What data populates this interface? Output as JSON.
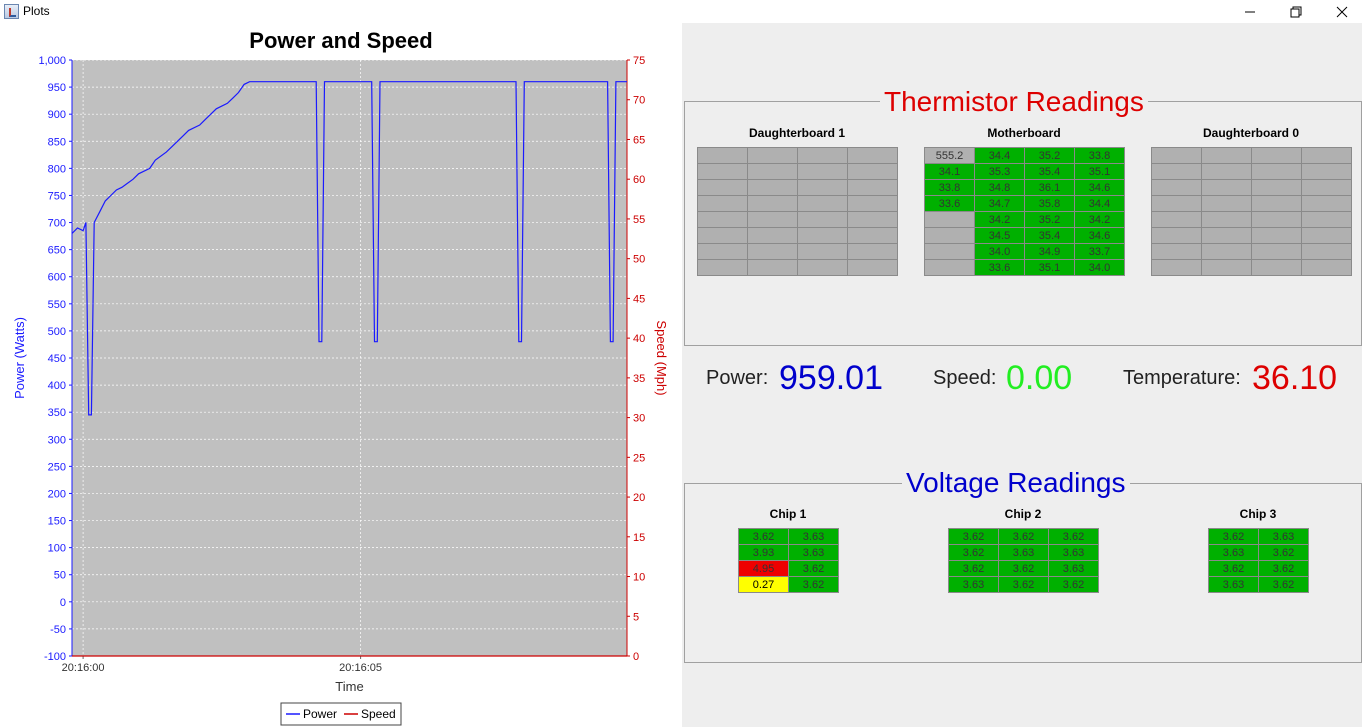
{
  "window": {
    "title": "Plots",
    "min_icon": "minimize-icon",
    "max_icon": "restore-icon",
    "close_icon": "close-icon"
  },
  "chart_data": {
    "type": "line",
    "title": "Power and Speed",
    "xlabel": "Time",
    "ylabel": "Power (Watts)",
    "y2label": "Speed (Mph)",
    "x_ticks": [
      "20:16:00",
      "20:16:05"
    ],
    "ylim": [
      -100,
      1000
    ],
    "y2lim": [
      0,
      75
    ],
    "y_ticks": [
      -100,
      -50,
      0,
      50,
      100,
      150,
      200,
      250,
      300,
      350,
      400,
      450,
      500,
      550,
      600,
      650,
      700,
      750,
      800,
      850,
      900,
      950,
      1000
    ],
    "y2_ticks": [
      0,
      5,
      10,
      15,
      20,
      25,
      30,
      35,
      40,
      45,
      50,
      55,
      60,
      65,
      70,
      75
    ],
    "xlim": [
      -0.2,
      9.8
    ],
    "grid": true,
    "background": "#c0c0c0",
    "legend_position": "bottom",
    "series": [
      {
        "name": "Power",
        "axis": "left",
        "color": "#1a1aff",
        "x": [
          -0.2,
          -0.1,
          0.0,
          0.05,
          0.1,
          0.15,
          0.2,
          0.3,
          0.4,
          0.5,
          0.6,
          0.7,
          0.9,
          1.0,
          1.2,
          1.3,
          1.5,
          1.6,
          1.8,
          1.9,
          2.1,
          2.2,
          2.4,
          2.6,
          2.7,
          2.8,
          2.9,
          3.0,
          3.0,
          4.2,
          4.25,
          4.3,
          4.35,
          5.2,
          5.25,
          5.3,
          5.35,
          7.8,
          7.85,
          7.9,
          7.95,
          9.45,
          9.5,
          9.55,
          9.6,
          9.8
        ],
        "y": [
          680,
          690,
          685,
          700,
          345,
          345,
          700,
          720,
          740,
          750,
          760,
          765,
          780,
          790,
          800,
          815,
          830,
          840,
          860,
          870,
          880,
          890,
          910,
          920,
          930,
          940,
          955,
          960,
          960,
          960,
          480,
          480,
          960,
          960,
          480,
          480,
          960,
          960,
          480,
          480,
          960,
          960,
          480,
          480,
          960,
          960
        ]
      },
      {
        "name": "Speed",
        "axis": "right",
        "color": "#cc0000",
        "x": [
          -0.2,
          9.8
        ],
        "y": [
          0,
          0
        ]
      }
    ]
  },
  "thermistor": {
    "title": "Thermistor Readings",
    "title_color": "#dd0000",
    "boards": [
      {
        "name": "Daughterboard 1",
        "cells": [
          [
            "",
            "",
            "",
            ""
          ],
          [
            "",
            "",
            "",
            ""
          ],
          [
            "",
            "",
            "",
            ""
          ],
          [
            "",
            "",
            "",
            ""
          ],
          [
            "",
            "",
            "",
            ""
          ],
          [
            "",
            "",
            "",
            ""
          ],
          [
            "",
            "",
            "",
            ""
          ],
          [
            "",
            "",
            "",
            ""
          ]
        ],
        "colors": [
          [
            "g",
            "g",
            "g",
            "g"
          ],
          [
            "g",
            "g",
            "g",
            "g"
          ],
          [
            "g",
            "g",
            "g",
            "g"
          ],
          [
            "g",
            "g",
            "g",
            "g"
          ],
          [
            "g",
            "g",
            "g",
            "g"
          ],
          [
            "g",
            "g",
            "g",
            "g"
          ],
          [
            "g",
            "g",
            "g",
            "g"
          ],
          [
            "g",
            "g",
            "g",
            "g"
          ]
        ]
      },
      {
        "name": "Motherboard",
        "cells": [
          [
            "555.2",
            "34.4",
            "35.2",
            "33.8"
          ],
          [
            "34.1",
            "35.3",
            "35.4",
            "35.1"
          ],
          [
            "33.8",
            "34.8",
            "36.1",
            "34.6"
          ],
          [
            "33.6",
            "34.7",
            "35.8",
            "34.4"
          ],
          [
            "",
            "34.2",
            "35.2",
            "34.2"
          ],
          [
            "",
            "34.5",
            "35.4",
            "34.6"
          ],
          [
            "",
            "34.0",
            "34.9",
            "33.7"
          ],
          [
            "",
            "33.6",
            "35.1",
            "34.0"
          ]
        ],
        "colors": [
          [
            "g",
            "G",
            "G",
            "G"
          ],
          [
            "G",
            "G",
            "G",
            "G"
          ],
          [
            "G",
            "G",
            "G",
            "G"
          ],
          [
            "G",
            "G",
            "G",
            "G"
          ],
          [
            "g",
            "G",
            "G",
            "G"
          ],
          [
            "g",
            "G",
            "G",
            "G"
          ],
          [
            "g",
            "G",
            "G",
            "G"
          ],
          [
            "g",
            "G",
            "G",
            "G"
          ]
        ]
      },
      {
        "name": "Daughterboard 0",
        "cells": [
          [
            "",
            "",
            "",
            ""
          ],
          [
            "",
            "",
            "",
            ""
          ],
          [
            "",
            "",
            "",
            ""
          ],
          [
            "",
            "",
            "",
            ""
          ],
          [
            "",
            "",
            "",
            ""
          ],
          [
            "",
            "",
            "",
            ""
          ],
          [
            "",
            "",
            "",
            ""
          ],
          [
            "",
            "",
            "",
            ""
          ]
        ],
        "colors": [
          [
            "g",
            "g",
            "g",
            "g"
          ],
          [
            "g",
            "g",
            "g",
            "g"
          ],
          [
            "g",
            "g",
            "g",
            "g"
          ],
          [
            "g",
            "g",
            "g",
            "g"
          ],
          [
            "g",
            "g",
            "g",
            "g"
          ],
          [
            "g",
            "g",
            "g",
            "g"
          ],
          [
            "g",
            "g",
            "g",
            "g"
          ],
          [
            "g",
            "g",
            "g",
            "g"
          ]
        ]
      }
    ]
  },
  "readouts": {
    "power": {
      "label": "Power:",
      "value": "959.01",
      "color": "#0000cc"
    },
    "speed": {
      "label": "Speed:",
      "value": "0.00",
      "color": "#22ee22"
    },
    "temperature": {
      "label": "Temperature:",
      "value": "36.10",
      "color": "#dd0000"
    }
  },
  "voltage": {
    "title": "Voltage Readings",
    "title_color": "#0000cc",
    "chips": [
      {
        "name": "Chip 1",
        "cells": [
          [
            "3.62",
            "3.63"
          ],
          [
            "3.93",
            "3.63"
          ],
          [
            "4.95",
            "3.62"
          ],
          [
            "0.27",
            "3.62"
          ]
        ],
        "colors": [
          [
            "G",
            "G"
          ],
          [
            "G",
            "G"
          ],
          [
            "R",
            "G"
          ],
          [
            "Y",
            "G"
          ]
        ]
      },
      {
        "name": "Chip 2",
        "cells": [
          [
            "3.62",
            "3.62",
            "3.62"
          ],
          [
            "3.62",
            "3.63",
            "3.63"
          ],
          [
            "3.62",
            "3.62",
            "3.63"
          ],
          [
            "3.63",
            "3.62",
            "3.62"
          ]
        ],
        "colors": [
          [
            "G",
            "G",
            "G"
          ],
          [
            "G",
            "G",
            "G"
          ],
          [
            "G",
            "G",
            "G"
          ],
          [
            "G",
            "G",
            "G"
          ]
        ]
      },
      {
        "name": "Chip 3",
        "cells": [
          [
            "3.62",
            "3.63"
          ],
          [
            "3.63",
            "3.62"
          ],
          [
            "3.62",
            "3.62"
          ],
          [
            "3.63",
            "3.62"
          ]
        ],
        "colors": [
          [
            "G",
            "G"
          ],
          [
            "G",
            "G"
          ],
          [
            "G",
            "G"
          ],
          [
            "G",
            "G"
          ]
        ]
      }
    ]
  }
}
